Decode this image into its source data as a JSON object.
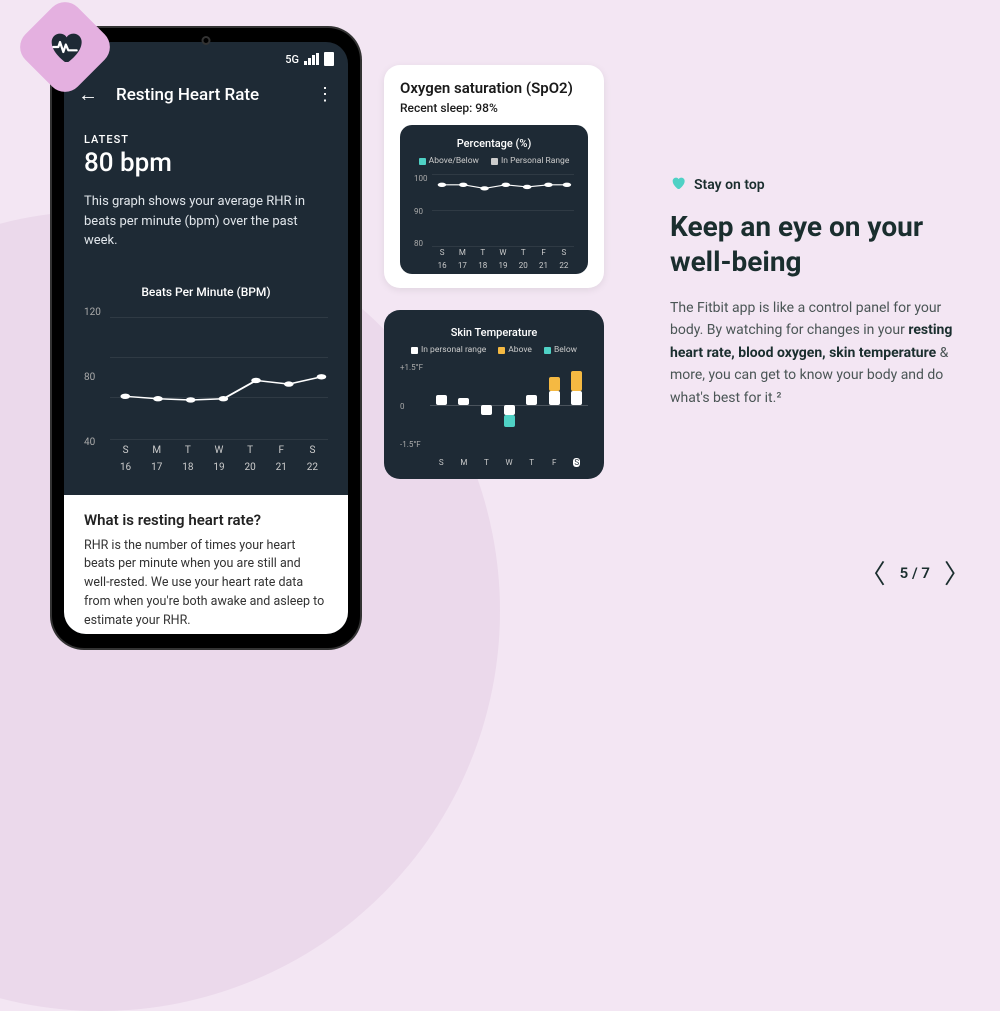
{
  "status_bar": {
    "network": "5G"
  },
  "app": {
    "title": "Resting Heart Rate",
    "latest_label": "LATEST",
    "latest_value": "80 bpm",
    "description": "This graph shows your average RHR in beats per minute (bpm) over the past week."
  },
  "bpm_chart": {
    "title": "Beats Per Minute (BPM)",
    "y_ticks": [
      "120",
      "80",
      "40"
    ],
    "days": [
      "S",
      "M",
      "T",
      "W",
      "T",
      "F",
      "S"
    ],
    "dates": [
      "16",
      "17",
      "18",
      "19",
      "20",
      "21",
      "22"
    ]
  },
  "info": {
    "title": "What is resting heart rate?",
    "text": "RHR is the number of times your heart beats per minute when you are still and well-rested. We use your heart rate data from when you're both awake and asleep to estimate your RHR."
  },
  "spo2": {
    "title": "Oxygen saturation (SpO2)",
    "subtitle": "Recent sleep: 98%",
    "chart_title": "Percentage (%)",
    "legend_a": "Above/Below",
    "legend_b": "In Personal Range",
    "y_ticks": [
      "100",
      "90",
      "80"
    ],
    "days": [
      "S",
      "M",
      "T",
      "W",
      "T",
      "F",
      "S"
    ],
    "dates": [
      "16",
      "17",
      "18",
      "19",
      "20",
      "21",
      "22"
    ]
  },
  "temp": {
    "title": "Skin Temperature",
    "legend_a": "In personal range",
    "legend_b": "Above",
    "legend_c": "Below",
    "y_ticks": [
      "+1.5°F",
      "0",
      "-1.5°F"
    ],
    "days": [
      "S",
      "M",
      "T",
      "W",
      "T",
      "F",
      "S"
    ]
  },
  "marketing": {
    "eyebrow": "Stay on top",
    "headline": "Keep an eye on your well-being",
    "body_pre": "The Fitbit app is like a control panel for your body. By watching for changes in your ",
    "body_strong": "resting heart rate, blood oxygen, skin temperature",
    "body_post": " & more, you can get to know your body and do what's best for it.²"
  },
  "pagination": {
    "current": "5",
    "sep": "/",
    "total": "7"
  },
  "chart_data": [
    {
      "type": "line",
      "title": "Beats Per Minute (BPM)",
      "categories": [
        "S 16",
        "M 17",
        "T 18",
        "W 19",
        "T 20",
        "F 21",
        "S 22"
      ],
      "values": [
        68,
        66,
        65,
        66,
        78,
        76,
        81
      ],
      "ylabel": "BPM",
      "ylim": [
        40,
        120
      ]
    },
    {
      "type": "line",
      "title": "Oxygen saturation Percentage (%)",
      "categories": [
        "S 16",
        "M 17",
        "T 18",
        "W 19",
        "T 20",
        "F 21",
        "S 22"
      ],
      "values": [
        97,
        97,
        96,
        97,
        96.5,
        97,
        97
      ],
      "ylabel": "%",
      "ylim": [
        80,
        100
      ]
    },
    {
      "type": "bar",
      "title": "Skin Temperature variation (°F)",
      "categories": [
        "S",
        "M",
        "T",
        "W",
        "T",
        "F",
        "S"
      ],
      "series": [
        {
          "name": "In personal range",
          "values": [
            0.3,
            0.2,
            -0.3,
            -0.3,
            0.3,
            0.6,
            0.6
          ]
        },
        {
          "name": "Above",
          "values": [
            0,
            0,
            0,
            0,
            0,
            0.7,
            0.9
          ]
        },
        {
          "name": "Below",
          "values": [
            0,
            0,
            0,
            -0.7,
            0,
            0,
            0
          ]
        }
      ],
      "ylabel": "°F",
      "ylim": [
        -1.5,
        1.5
      ]
    }
  ]
}
